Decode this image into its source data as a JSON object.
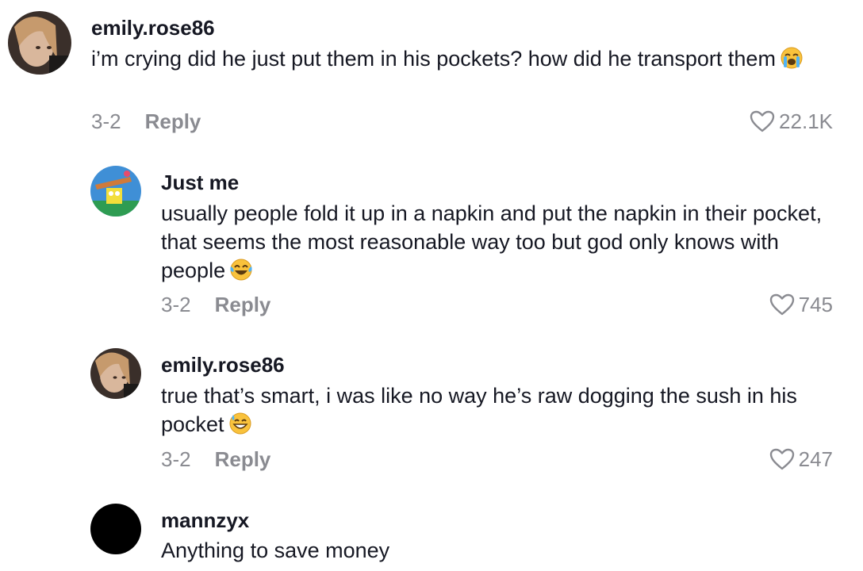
{
  "comments": [
    {
      "username": "emily.rose86",
      "text": "i’m crying did he just put them in his pockets? how did he transport them",
      "emoji": "loudly-crying-face",
      "date": "3-2",
      "reply_label": "Reply",
      "likes": "22.1K"
    },
    {
      "username": "Just me",
      "text": "usually people fold it up in a napkin and put the napkin in their pocket, that seems the most reasonable way too but god only knows with people",
      "emoji": "tears-of-joy-face",
      "date": "3-2",
      "reply_label": "Reply",
      "likes": "745"
    },
    {
      "username": "emily.rose86",
      "text": "true that’s smart, i was like no way he’s raw dogging the sush in his pocket",
      "emoji": "grinning-sweat-face",
      "date": "3-2",
      "reply_label": "Reply",
      "likes": "247"
    },
    {
      "username": "mannzyx",
      "text": "Anything to save money"
    }
  ],
  "colors": {
    "text": "#161823",
    "muted": "#8a8b91",
    "background": "#ffffff"
  },
  "icons": {
    "like": "heart-outline-icon"
  }
}
